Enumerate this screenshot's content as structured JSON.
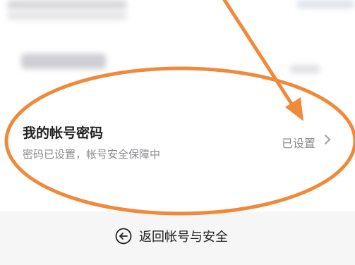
{
  "account_password_row": {
    "title": "我的帐号密码",
    "description": "密码已设置，帐号安全保障中",
    "status": "已设置",
    "chevron_icon": "chevron-right-icon"
  },
  "back_link": {
    "label": "返回帐号与安全",
    "icon": "back-arrow-circle-icon"
  },
  "colors": {
    "annotation_orange": "#f08a3a",
    "text_primary": "#222222",
    "text_secondary": "#8a8a8f",
    "background": "#f6f6f7",
    "card": "#ffffff"
  }
}
